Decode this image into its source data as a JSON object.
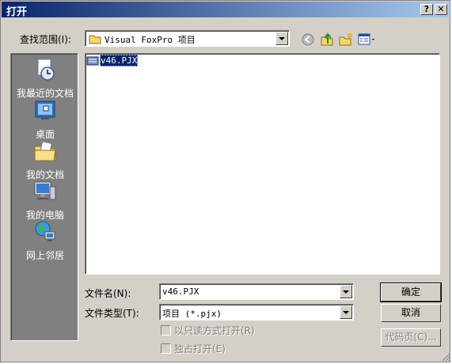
{
  "window": {
    "title": "打开",
    "help_label": "?",
    "close_label": "✕"
  },
  "look_in": {
    "label": "查找范围(I):",
    "value": "Visual FoxPro 项目"
  },
  "toolbar": {
    "back_icon": "back-icon",
    "up_icon": "up-folder-icon",
    "new_folder_icon": "new-folder-icon",
    "views_icon": "views-menu-icon"
  },
  "places": [
    {
      "label": "我最近的文档",
      "icon": "recent-documents-icon"
    },
    {
      "label": "桌面",
      "icon": "desktop-icon"
    },
    {
      "label": "我的文档",
      "icon": "my-documents-icon"
    },
    {
      "label": "我的电脑",
      "icon": "my-computer-icon"
    },
    {
      "label": "网上邻居",
      "icon": "network-places-icon"
    }
  ],
  "files": [
    {
      "name": "v46.PJX",
      "selected": true
    }
  ],
  "filename": {
    "label": "文件名(N):",
    "value": "v46.PJX"
  },
  "filetype": {
    "label": "文件类型(T):",
    "value": "项目 (*.pjx)"
  },
  "options": {
    "readonly_label": "以只读方式打开(R)",
    "exclusive_label": "独占打开(E)"
  },
  "buttons": {
    "ok": "确定",
    "cancel": "取消",
    "codepage": "代码页(C)..."
  },
  "colors": {
    "titlebar_start": "#0a246a",
    "titlebar_end": "#a6caf0",
    "face": "#d4d0c8",
    "selection": "#0a246a"
  }
}
